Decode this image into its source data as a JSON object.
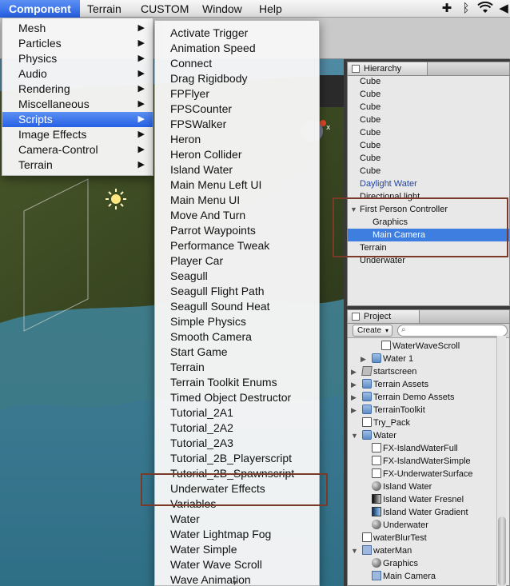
{
  "menubar": {
    "items": [
      "Component",
      "Terrain",
      "CUSTOM",
      "Window",
      "Help"
    ],
    "active": "Component"
  },
  "component_menu": {
    "items": [
      {
        "label": "Mesh",
        "submenu": true
      },
      {
        "label": "Particles",
        "submenu": true
      },
      {
        "label": "Physics",
        "submenu": true
      },
      {
        "label": "Audio",
        "submenu": true
      },
      {
        "label": "Rendering",
        "submenu": true
      },
      {
        "label": "Miscellaneous",
        "submenu": true
      },
      {
        "label": "Scripts",
        "submenu": true
      },
      {
        "label": "Image Effects",
        "submenu": true
      },
      {
        "label": "Camera-Control",
        "submenu": true
      },
      {
        "label": "Terrain",
        "submenu": true
      }
    ],
    "highlighted": "Scripts"
  },
  "scripts_menu": {
    "items": [
      "Activate Trigger",
      "Animation Speed",
      "Connect",
      "Drag Rigidbody",
      "FPFlyer",
      "FPSCounter",
      "FPSWalker",
      "Heron",
      "Heron Collider",
      "Island Water",
      "Main Menu Left UI",
      "Main Menu UI",
      "Move And Turn",
      "Parrot Waypoints",
      "Performance Tweak",
      "Player Car",
      "Seagull",
      "Seagull Flight Path",
      "Seagull Sound Heat",
      "Simple Physics",
      "Smooth Camera",
      "Start Game",
      "Terrain",
      "Terrain Toolkit Enums",
      "Timed Object Destructor",
      "Tutorial_2A1",
      "Tutorial_2A2",
      "Tutorial_2A3",
      "Tutorial_2B_Playerscript",
      "Tutorial_2B_Spawnscript",
      "Underwater Effects",
      "Variables",
      "Water",
      "Water Lightmap Fog",
      "Water Simple",
      "Water Wave Scroll",
      "Wave Animation"
    ]
  },
  "hierarchy": {
    "tab_label": "Hierarchy",
    "rows": [
      {
        "label": "Cube",
        "indent": 0
      },
      {
        "label": "Cube",
        "indent": 0
      },
      {
        "label": "Cube",
        "indent": 0
      },
      {
        "label": "Cube",
        "indent": 0
      },
      {
        "label": "Cube",
        "indent": 0
      },
      {
        "label": "Cube",
        "indent": 0
      },
      {
        "label": "Cube",
        "indent": 0
      },
      {
        "label": "Cube",
        "indent": 0
      },
      {
        "label": "Daylight Water",
        "indent": 0,
        "blue": true
      },
      {
        "label": "Directional light",
        "indent": 0
      },
      {
        "label": "First Person Controller",
        "indent": 0,
        "expanded": true
      },
      {
        "label": "Graphics",
        "indent": 1
      },
      {
        "label": "Main Camera",
        "indent": 1,
        "selected": true
      },
      {
        "label": "Terrain",
        "indent": 0
      },
      {
        "label": "Underwater",
        "indent": 0
      }
    ]
  },
  "project": {
    "tab_label": "Project",
    "create_label": "Create",
    "rows": [
      {
        "label": "WaterWaveScroll",
        "indent": 4,
        "icon": "script",
        "tri": ""
      },
      {
        "label": "Water 1",
        "indent": 2,
        "icon": "folder",
        "tri": "right"
      },
      {
        "label": "startscreen",
        "indent": 0,
        "icon": "cube",
        "tri": "right"
      },
      {
        "label": "Terrain Assets",
        "indent": 0,
        "icon": "folder",
        "tri": "right"
      },
      {
        "label": "Terrain Demo Assets",
        "indent": 0,
        "icon": "folder",
        "tri": "right"
      },
      {
        "label": "TerrainToolkit",
        "indent": 0,
        "icon": "folder",
        "tri": "right"
      },
      {
        "label": "Try_Pack",
        "indent": 0,
        "icon": "script",
        "tri": ""
      },
      {
        "label": "Water",
        "indent": 0,
        "icon": "folder",
        "tri": "down"
      },
      {
        "label": "FX-IslandWaterFull",
        "indent": 2,
        "icon": "script",
        "tri": ""
      },
      {
        "label": "FX-IslandWaterSimple",
        "indent": 2,
        "icon": "script",
        "tri": ""
      },
      {
        "label": "FX-UnderwaterSurface",
        "indent": 2,
        "icon": "script",
        "tri": ""
      },
      {
        "label": "Island Water",
        "indent": 2,
        "icon": "sphere",
        "tri": ""
      },
      {
        "label": "Island Water Fresnel",
        "indent": 2,
        "icon": "fresnel",
        "tri": ""
      },
      {
        "label": "Island Water Gradient",
        "indent": 2,
        "icon": "gradient",
        "tri": ""
      },
      {
        "label": "Underwater",
        "indent": 2,
        "icon": "sphere",
        "tri": ""
      },
      {
        "label": "waterBlurTest",
        "indent": 0,
        "icon": "script",
        "tri": ""
      },
      {
        "label": "waterMan",
        "indent": 0,
        "icon": "pre",
        "tri": "down"
      },
      {
        "label": "Graphics",
        "indent": 2,
        "icon": "sphere",
        "tri": ""
      },
      {
        "label": "Main Camera",
        "indent": 2,
        "icon": "pre",
        "tri": ""
      }
    ]
  },
  "colors": {
    "highlight": "#2660e5",
    "selection": "#3d7ee0",
    "annotation": "#7a3a28"
  }
}
